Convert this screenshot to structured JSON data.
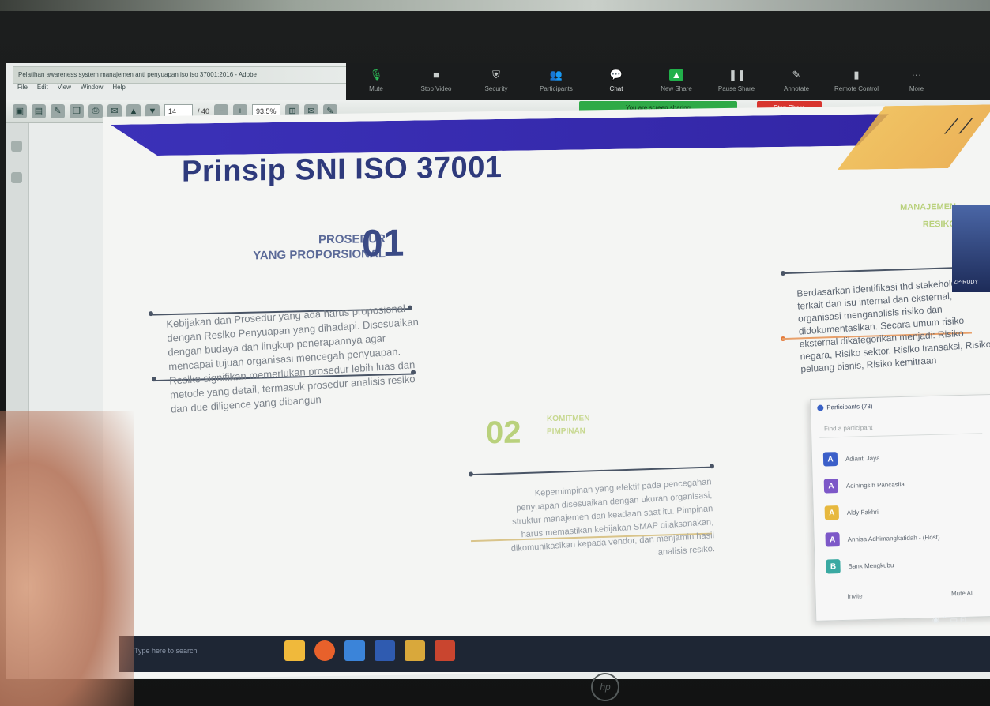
{
  "pdf_window": {
    "title": "Pelatihan awareness system manajemen anti penyuapan iso iso 37001:2016 - Adobe",
    "menu": [
      "File",
      "Edit",
      "View",
      "Window",
      "Help"
    ],
    "page_current": "14",
    "page_total": "/ 40",
    "zoom": "93.5%"
  },
  "zoom_controls": {
    "items": [
      {
        "label": "Mute",
        "icon": "mic-icon"
      },
      {
        "label": "Stop Video",
        "icon": "video-camera-icon"
      },
      {
        "label": "Security",
        "icon": "shield-icon"
      },
      {
        "label": "Participants",
        "icon": "participants-icon",
        "count": "73"
      },
      {
        "label": "Chat",
        "icon": "chat-icon"
      },
      {
        "label": "New Share",
        "icon": "share-icon"
      },
      {
        "label": "Pause Share",
        "icon": "pause-icon"
      },
      {
        "label": "Annotate",
        "icon": "pen-icon"
      },
      {
        "label": "Remote Control",
        "icon": "mouse-icon"
      },
      {
        "label": "More",
        "icon": "more-icon"
      }
    ],
    "share_banner": "You are screen sharing",
    "stop_share": "Stop Share"
  },
  "slide": {
    "title": "Prinsip SNI ISO 37001",
    "section1": {
      "heading_line1": "PROSEDUR",
      "heading_line2": "YANG PROPORSIONAL",
      "number": "01",
      "body": "Kebijakan dan Prosedur yang ada harus proposional dengan Resiko Penyuapan yang dihadapi. Disesuaikan dengan budaya dan lingkup penerapannya agar mencapai tujuan organisasi mencegah penyuapan. Resiko signifikan memerlukan prosedur lebih luas dan metode yang detail, termasuk prosedur analisis resiko dan due diligence yang dibangun"
    },
    "section2": {
      "number": "02",
      "heading_line1": "KOMITMEN",
      "heading_line2": "PIMPINAN",
      "body": "Kepemimpinan yang efektif pada pencegahan penyuapan disesuaikan dengan ukuran organisasi, struktur manajemen dan keadaan saat itu. Pimpinan harus memastikan kebijakan SMAP dilaksanakan, dikomunikasikan kepada vendor, dan menjamin hasil analisis resiko."
    },
    "section3": {
      "heading_line1": "MANAJEMEN",
      "heading_line2": "RESIKO",
      "body": "Berdasarkan identifikasi thd stakeholder yang terkait dan isu internal dan eksternal, organisasi menganalisis risiko dan didokumentasikan. Secara umum risiko eksternal dikategorikan menjadi: Risiko negara, Risiko sektor, Risiko transaksi, Risiko peluang bisnis, Risiko kemitraan"
    }
  },
  "video": {
    "label": "ZP-RUDY"
  },
  "participants_panel": {
    "title": "Participants (73)",
    "search_placeholder": "Find a participant",
    "rows": [
      {
        "initial": "A",
        "name": "Adianti Jaya",
        "color": "#3b5fc9"
      },
      {
        "initial": "A",
        "name": "Adiningsih Pancasila",
        "color": "#7d58c8"
      },
      {
        "initial": "A",
        "name": "Aldy Fakhri",
        "color": "#e7b83e"
      },
      {
        "initial": "A",
        "name": "Annisa Adhimangkatidah - (Host)",
        "color": "#7d58c8"
      },
      {
        "initial": "B",
        "name": "Bank Mengkubu",
        "color": "#3aa9a2"
      }
    ],
    "invite": "Invite",
    "mute_all": "Mute All"
  },
  "taskbar": {
    "search": "Type here to search",
    "apps": [
      {
        "name": "file-explorer-icon",
        "color": "#f0b93b"
      },
      {
        "name": "firefox-icon",
        "color": "#e8612b"
      },
      {
        "name": "mail-icon",
        "color": "#3b84d9"
      },
      {
        "name": "word-icon",
        "color": "#2f5bb0"
      },
      {
        "name": "chrome-icon",
        "color": "#d9a83b"
      },
      {
        "name": "powerpoint-icon",
        "color": "#c9452f"
      }
    ]
  }
}
